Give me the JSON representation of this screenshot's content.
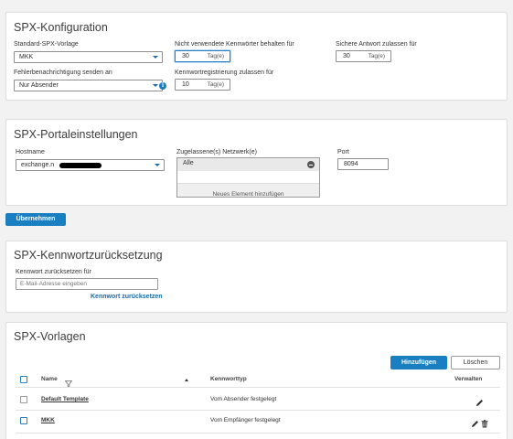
{
  "konfiguration": {
    "title": "SPX-Konfiguration",
    "standard_vorlage_label": "Standard-SPX-Vorlage",
    "standard_vorlage_value": "MKK",
    "fehler_label": "Fehlerbenachrichtigung senden an",
    "fehler_value": "Nur Absender",
    "nicht_verwendete_label": "Nicht verwendete Kennwörter behalten für",
    "nicht_verwendete_value": "30",
    "nicht_verwendete_unit": "Tag(e)",
    "registrierung_label": "Kennwortregistrierung zulassen für",
    "registrierung_value": "10",
    "registrierung_unit": "Tag(e)",
    "sichere_antwort_label": "Sichere Antwort zulassen für",
    "sichere_antwort_value": "30",
    "sichere_antwort_unit": "Tag(e)",
    "info_icon": "i"
  },
  "portal": {
    "title": "SPX-Portaleinstellungen",
    "hostname_label": "Hostname",
    "hostname_value": "exchange.n",
    "netzwerk_label": "Zugelassene(s) Netzwerk(e)",
    "netzwerk_item": "Alle",
    "add_element": "Neues Element hinzufügen",
    "port_label": "Port",
    "port_value": "8094"
  },
  "apply_button": "Übernehmen",
  "reset": {
    "title": "SPX-Kennwortzurücksetzung",
    "field_label": "Kennwort zurücksetzen für",
    "placeholder": "E-Mail-Adresse eingeben",
    "link": "Kennwort zurücksetzen"
  },
  "vorlagen": {
    "title": "SPX-Vorlagen",
    "add_button": "Hinzufügen",
    "delete_button": "Löschen",
    "col_name": "Name",
    "col_type": "Kennworttyp",
    "col_manage": "Verwalten",
    "rows": [
      {
        "name": "Default Template",
        "type": "Vom Absender festgelegt"
      },
      {
        "name": "MKK",
        "type": "Vom Empfänger festgelegt"
      }
    ]
  },
  "colors": {
    "accent": "#1a7fc1",
    "panel_bg": "#ffffff",
    "page_bg": "#f2f2f2"
  }
}
